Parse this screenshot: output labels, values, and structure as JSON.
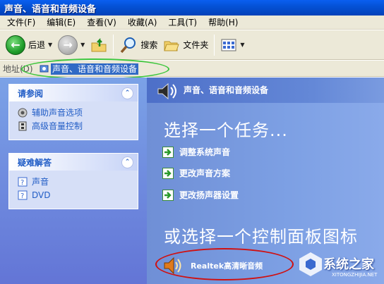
{
  "window": {
    "title": "声音、语音和音频设备"
  },
  "menu": [
    "文件(F)",
    "编辑(E)",
    "查看(V)",
    "收藏(A)",
    "工具(T)",
    "帮助(H)"
  ],
  "toolbar": {
    "back_label": "后退",
    "search_label": "搜索",
    "folders_label": "文件夹"
  },
  "address": {
    "label": "地址(D)",
    "value": "声音、语音和音频设备"
  },
  "left_panels": [
    {
      "title": "请参阅",
      "links": [
        "辅助声音选项",
        "高级音量控制"
      ]
    },
    {
      "title": "疑难解答",
      "links": [
        "声音",
        "DVD"
      ]
    }
  ],
  "main": {
    "header_title": "声音、语音和音频设备",
    "task_heading": "选择一个任务...",
    "tasks": [
      "调整系统声音",
      "更改声音方案",
      "更改扬声器设置"
    ],
    "cp_heading": "或选择一个控制面板图标",
    "items": [
      "Realtek高清晰音频"
    ]
  },
  "watermark": {
    "text": "系统之家",
    "sub": "XITONGZHIJIA.NET"
  },
  "colors": {
    "title_bar": "#0452d6",
    "task_pane": "#6375d6",
    "link": "#215dc6",
    "address_highlight": "#3cc63c",
    "item_highlight": "#d01010"
  }
}
